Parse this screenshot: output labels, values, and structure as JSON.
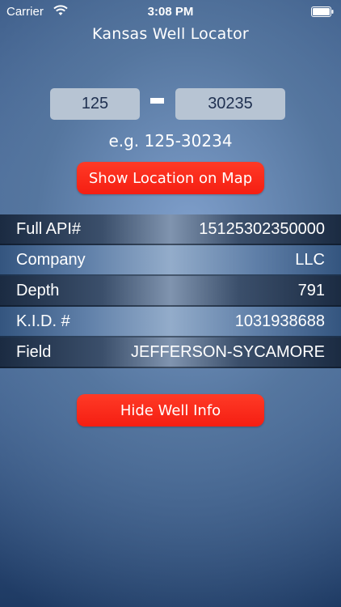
{
  "status_bar": {
    "carrier": "Carrier",
    "time": "3:08 PM",
    "wifi_icon": "wifi-icon",
    "battery_icon": "battery-icon"
  },
  "app": {
    "title": "Kansas Well Locator"
  },
  "api_input": {
    "county_code": "125",
    "well_number": "30235",
    "separator": "-",
    "example": "e.g. 125-30234"
  },
  "buttons": {
    "show_map": "Show Location on Map",
    "hide_info": "Hide Well Info"
  },
  "well_info": [
    {
      "label": "Full API#",
      "value": "15125302350000"
    },
    {
      "label": "Company",
      "value": "LLC"
    },
    {
      "label": "Depth",
      "value": "791"
    },
    {
      "label": "K.I.D. #",
      "value": "1031938688"
    },
    {
      "label": "Field",
      "value": "JEFFERSON-SYCAMORE"
    }
  ],
  "colors": {
    "button_red": "#ff2a1a",
    "input_bg": "#b7c4d3",
    "text": "#ffffff"
  }
}
